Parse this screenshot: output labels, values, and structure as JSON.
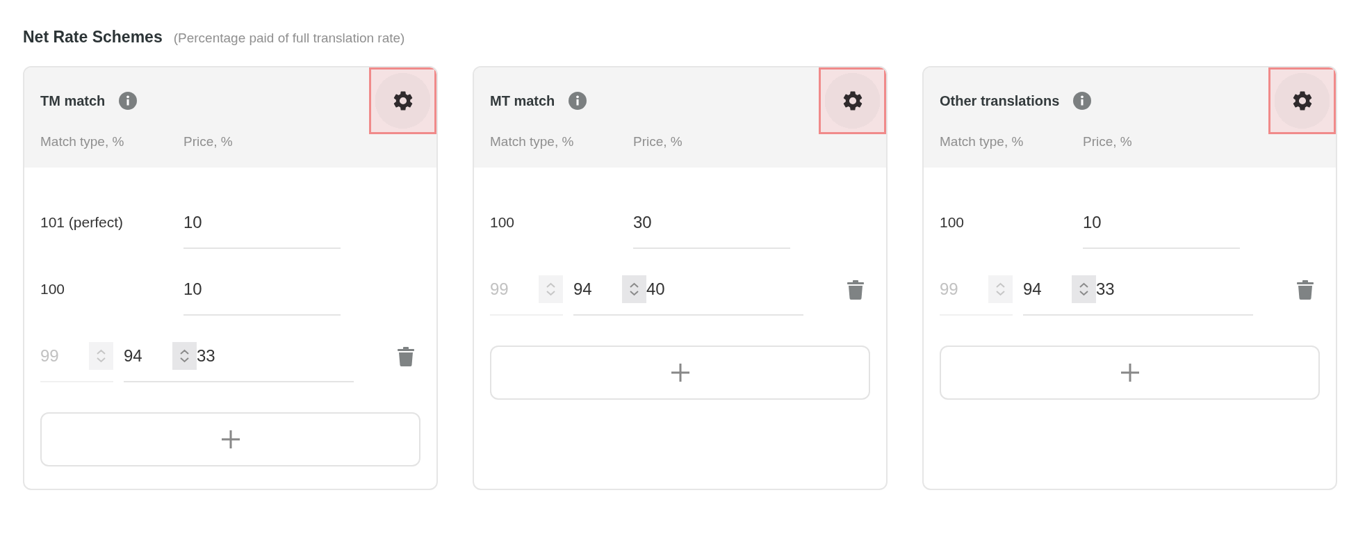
{
  "heading": {
    "title": "Net Rate Schemes",
    "subtitle": "(Percentage paid of full translation rate)"
  },
  "schemes": [
    {
      "title": "TM match",
      "settings_highlighted": true,
      "columns": [
        "Match type, %",
        "Price, %"
      ],
      "rows": [
        {
          "kind": "fixed",
          "match": "101 (perfect)",
          "price": "10"
        },
        {
          "kind": "fixed",
          "match": "100",
          "price": "10"
        },
        {
          "kind": "range",
          "from": "99",
          "from_disabled": true,
          "to": "94",
          "price": "33"
        }
      ]
    },
    {
      "title": "MT match",
      "settings_highlighted": true,
      "columns": [
        "Match type, %",
        "Price, %"
      ],
      "rows": [
        {
          "kind": "fixed",
          "match": "100",
          "price": "30"
        },
        {
          "kind": "range",
          "from": "99",
          "from_disabled": true,
          "to": "94",
          "price": "40"
        }
      ]
    },
    {
      "title": "Other translations",
      "settings_highlighted": true,
      "columns": [
        "Match type, %",
        "Price, %"
      ],
      "rows": [
        {
          "kind": "fixed",
          "match": "100",
          "price": "10"
        },
        {
          "kind": "range",
          "from": "99",
          "from_disabled": true,
          "to": "94",
          "price": "33"
        }
      ]
    }
  ]
}
